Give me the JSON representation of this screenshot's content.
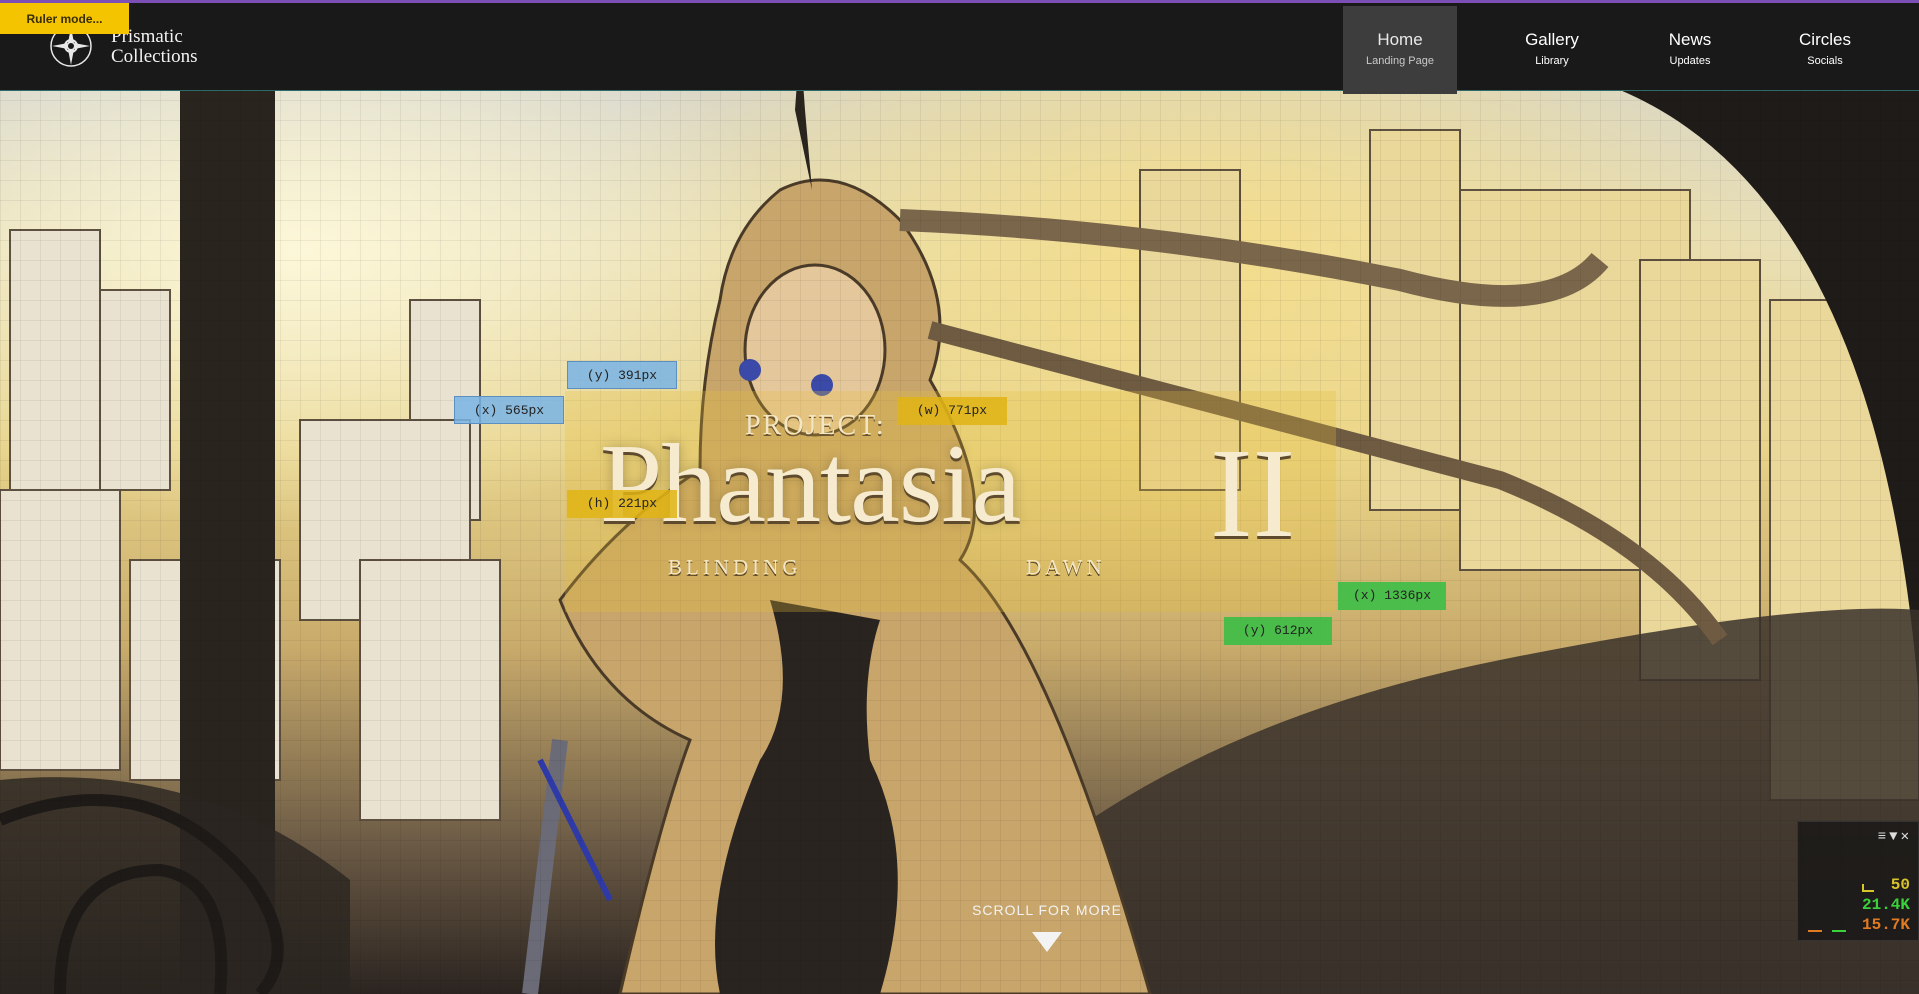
{
  "ruler": {
    "button_label": "Ruler mode..."
  },
  "brand": {
    "line1": "Prismatic",
    "line2": "Collections"
  },
  "nav": {
    "items": [
      {
        "title": "Home",
        "subtitle": "Landing Page",
        "active": true
      },
      {
        "title": "Gallery",
        "subtitle": "Library"
      },
      {
        "title": "News",
        "subtitle": "Updates"
      },
      {
        "title": "Circles",
        "subtitle": "Socials"
      }
    ]
  },
  "hero": {
    "title_top": "PROJECT:",
    "title_main": "Phantasia",
    "title_numeral": "II",
    "subtitle_left": "BLINDING",
    "subtitle_right": "DAWN"
  },
  "measure": {
    "x1": "(x) 565px",
    "y1": "(y) 391px",
    "w": "(w) 771px",
    "h": "(h) 221px",
    "x2": "(x) 1336px",
    "y2": "(y) 612px"
  },
  "scroll": {
    "label": "SCROLL FOR MORE"
  },
  "stats": {
    "fps": "50",
    "a": "21.4K",
    "b": "15.7K"
  },
  "colors": {
    "accent_top": "#7b4fb6",
    "ruler": "#f5c400",
    "selection": "#e6be3c"
  },
  "icons": {
    "logo": "compass-star-icon",
    "menu": "hamburger-icon",
    "collapse": "triangle-down-icon",
    "close": "close-icon"
  }
}
